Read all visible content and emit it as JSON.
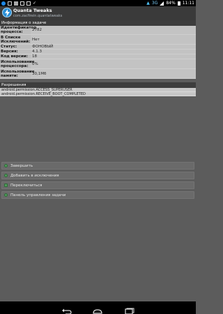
{
  "status_bar": {
    "battery": "84%",
    "time": "11:11",
    "network": "3G",
    "left_icons": [
      "notification-icon",
      "screenshot-icon",
      "image-icon",
      "mail-icon",
      "mail-icon",
      "check-icon"
    ]
  },
  "header": {
    "title": "Quanta Tweaks",
    "package": "com.zacfirein.quantatweaks",
    "icon": "lightning-icon",
    "icon_color": "#2a8fd6"
  },
  "task_info": {
    "section_title": "Информация о задаче",
    "rows": [
      {
        "key": "Идентификатор процесса:",
        "value": "2782"
      },
      {
        "key": "В Списке Исключений:",
        "value": "Нет"
      },
      {
        "key": "Статус:",
        "value": "ФОНОВЫЙ"
      },
      {
        "key": "Версия:",
        "value": "4.1.3"
      },
      {
        "key": "Код версии:",
        "value": "18"
      },
      {
        "key": "Использование процессора:",
        "value": "0%"
      },
      {
        "key": "Использование памяти:",
        "value": "30,1Мб"
      }
    ]
  },
  "permissions": {
    "section_title": "Разрешения",
    "items": [
      "android.permission.ACCESS_SUPERUSER",
      "android.permission.RECEIVE_BOOT_COMPLETED"
    ]
  },
  "actions": [
    {
      "label": "Завершить",
      "icon": "stop-icon"
    },
    {
      "label": "Добавить в исключения",
      "icon": "shield-icon"
    },
    {
      "label": "Переключиться",
      "icon": "switch-icon"
    },
    {
      "label": "Панель управления задачи",
      "icon": "settings-icon"
    }
  ],
  "nav_bar": [
    "back-icon",
    "home-icon",
    "recents-icon"
  ]
}
